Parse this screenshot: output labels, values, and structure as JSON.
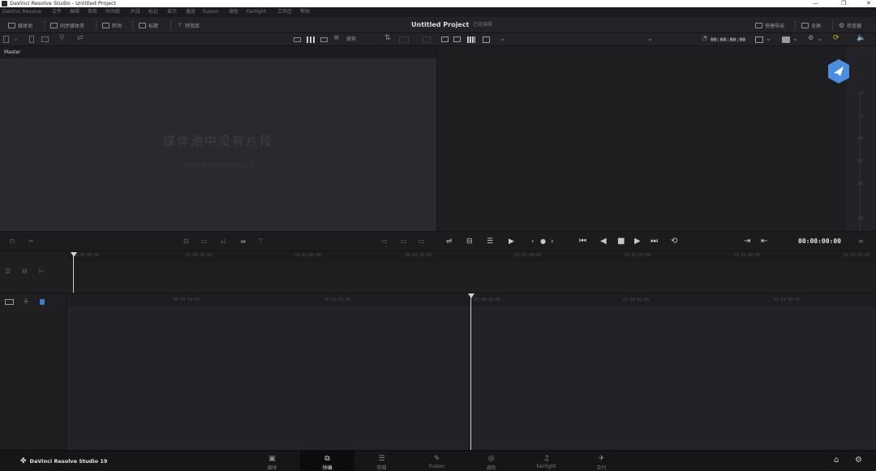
{
  "window": {
    "title": "DaVinci Resolve Studio - Untitled Project",
    "controls": [
      "—",
      "❐",
      "✕"
    ]
  },
  "menu": [
    "DaVinci Resolve",
    "文件",
    "编辑",
    "修剪",
    "时间线",
    "片段",
    "标记",
    "显示",
    "播放",
    "Fusion",
    "调色",
    "Fairlight",
    "工作区",
    "帮助"
  ],
  "toolbar": {
    "media_pool": "媒体池",
    "sync_bin": "同步媒体夹",
    "transitions": "转场",
    "titles": "标题",
    "effects": "特效库",
    "project_title": "Untitled Project",
    "project_status": "已经编辑",
    "quick_export": "快捷导出",
    "fullscreen": "全屏",
    "inspector": "检查器"
  },
  "media_pool": {
    "view_label": "搜索",
    "bin_name": "Master",
    "empty_title": "媒体池中没有片段",
    "empty_subtitle": "从媒体存储中添加片段来开始工作"
  },
  "viewer": {
    "timecode_top": "00:00:00:00",
    "timecode": "00:00:00:00"
  },
  "meter": {
    "ticks": [
      "0",
      "-5",
      "-10",
      "-15",
      "-20",
      "-30",
      "-40",
      "-50"
    ]
  },
  "timeline": {
    "upper_ruler": [
      "01:00:00:00",
      "01:00:30:00",
      "01:01:00:00",
      "01:01:30:00",
      "01:02:00:00",
      "01:02:30:00",
      "01:03:00:00",
      "01:03:30:00"
    ],
    "lower_ruler": [
      "00:59:54:00",
      "00:59:58:00",
      "01:00:00:00",
      "01:00:02:00",
      "01:00:04:00"
    ]
  },
  "pages": {
    "brand": "DaVinci Resolve Studio 19",
    "tabs": [
      "媒体",
      "快编",
      "剪辑",
      "Fusion",
      "调色",
      "Fairlight",
      "交付"
    ],
    "active": "快编"
  },
  "colors": {
    "accent": "#3a7fd6",
    "badge": "#4a8ee0"
  }
}
